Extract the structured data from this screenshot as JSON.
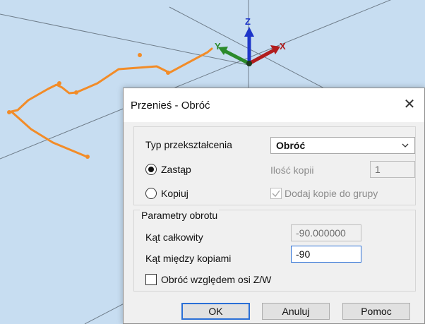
{
  "viewport": {
    "axes": {
      "z": "Z",
      "y": "Y",
      "x": "X"
    },
    "colors": {
      "path": "#f28c28",
      "z_axis": "#1d35c9",
      "y_axis": "#2b8a2b",
      "x_axis": "#b11d1d",
      "grid": "#6f7d8a"
    }
  },
  "dialog": {
    "title": "Przenieś - Obróć",
    "close_icon": "close-icon",
    "transform_type_label": "Typ przekształcenia",
    "transform_type_value": "Obróć",
    "option_replace_label": "Zastąp",
    "option_copy_label": "Kopiuj",
    "copies_count_label": "Ilość kopii",
    "copies_count_value": "1",
    "add_copies_label": "Dodaj kopie do grupy",
    "add_copies_checked": true,
    "rotation_group_label": "Parametry obrotu",
    "total_angle_label": "Kąt całkowity",
    "total_angle_value": "-90.000000",
    "angle_between_label": "Kąt między kopiami",
    "angle_between_value": "-90",
    "rotate_axis_label": "Obróć względem osi Z/W",
    "rotate_axis_checked": false,
    "ok_label": "OK",
    "cancel_label": "Anuluj",
    "help_label": "Pomoc",
    "accent_color": "#2a6fd6"
  }
}
